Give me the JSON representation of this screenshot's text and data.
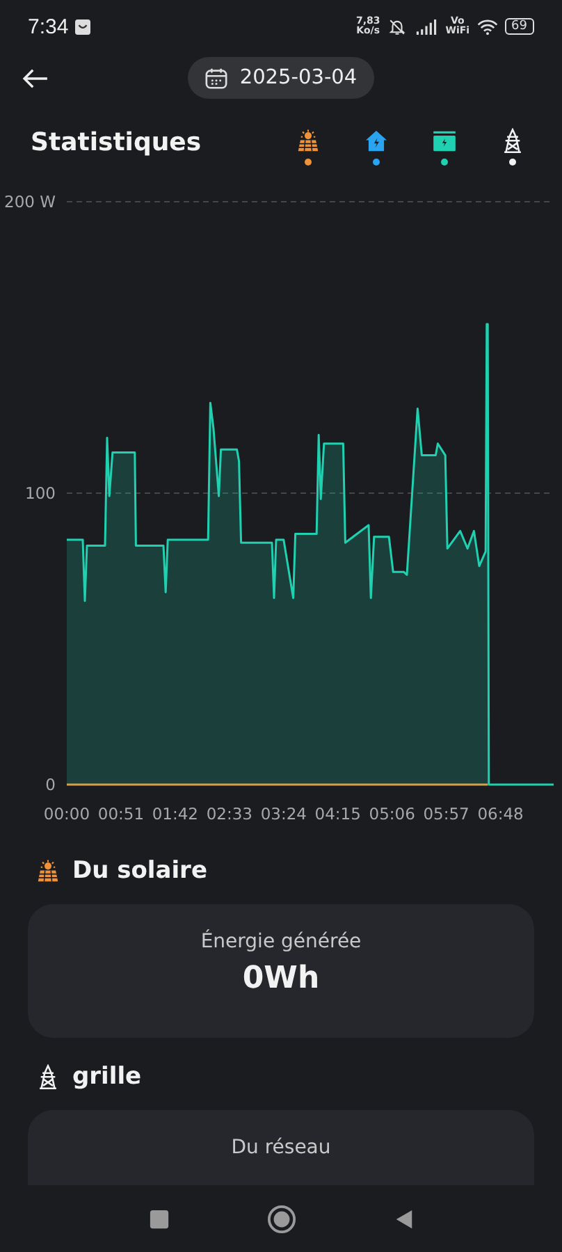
{
  "status_bar": {
    "time": "7:34",
    "speed": "7,83",
    "speed_unit": "Ko/s",
    "volte": "Vo",
    "volte_sub": "WiFi",
    "battery": "69"
  },
  "header": {
    "date": "2025-03-04"
  },
  "title": "Statistiques",
  "legend": [
    {
      "kind": "solar",
      "color": "#f0923a"
    },
    {
      "kind": "home",
      "color": "#2aa3f0"
    },
    {
      "kind": "battery",
      "color": "#1fd1b0"
    },
    {
      "kind": "grid",
      "color": "#f2f2f2"
    }
  ],
  "chart": {
    "chart_data": {
      "type": "line",
      "x": [
        0,
        15,
        17,
        19,
        36,
        38,
        40,
        43,
        64,
        65,
        91,
        93,
        95,
        133,
        135,
        138,
        143,
        145,
        160,
        162,
        164,
        193,
        195,
        197,
        204,
        213,
        215,
        235,
        237,
        239,
        242,
        260,
        262,
        284,
        286,
        289,
        303,
        307,
        317,
        320,
        330,
        334,
        347,
        349,
        356,
        358,
        370,
        377,
        383,
        388,
        394,
        395,
        396,
        397,
        458
      ],
      "series": [
        {
          "color": "#1fd1b0",
          "values": [
            84,
            84,
            63,
            82,
            82,
            119,
            99,
            114,
            114,
            82,
            82,
            66,
            84,
            84,
            131,
            122,
            99,
            115,
            115,
            111,
            83,
            83,
            64,
            84,
            84,
            64,
            86,
            86,
            120,
            98,
            117,
            117,
            83,
            89,
            64,
            85,
            85,
            73,
            73,
            72,
            129,
            113,
            113,
            117,
            113,
            81,
            87,
            81,
            87,
            75,
            80,
            158,
            158,
            0,
            0
          ]
        },
        {
          "color": "#d4a04a",
          "values": [
            0,
            0,
            0,
            0,
            0,
            0,
            0,
            0,
            0,
            0,
            0,
            0,
            0,
            0,
            0,
            0,
            0,
            0,
            0,
            0,
            0,
            0,
            0,
            0,
            0,
            0,
            0,
            0,
            0,
            0,
            0,
            0,
            0,
            0,
            0,
            0,
            0,
            0,
            0,
            0,
            0,
            0,
            0,
            0,
            0,
            0,
            0,
            0,
            0,
            0,
            0,
            0,
            0,
            null,
            null
          ]
        }
      ],
      "xlim": [
        0,
        458
      ],
      "ylim": [
        0,
        200
      ],
      "yticks": [
        0,
        100,
        {
          "value": 200,
          "label": "200 W"
        }
      ],
      "xticks": [
        {
          "value": 0,
          "label": "00:00"
        },
        {
          "value": 51,
          "label": "00:51"
        },
        {
          "value": 102,
          "label": "01:42"
        },
        {
          "value": 153,
          "label": "02:33"
        },
        {
          "value": 204,
          "label": "03:24"
        },
        {
          "value": 255,
          "label": "04:15"
        },
        {
          "value": 306,
          "label": "05:06"
        },
        {
          "value": 357,
          "label": "05:57"
        },
        {
          "value": 408,
          "label": "06:48"
        }
      ]
    }
  },
  "sections": [
    {
      "kind": "solar",
      "title": "Du solaire",
      "card": {
        "label": "Énergie générée",
        "value": "0Wh"
      }
    },
    {
      "kind": "grid",
      "title": "grille",
      "card": {
        "label": "Du réseau"
      }
    }
  ]
}
